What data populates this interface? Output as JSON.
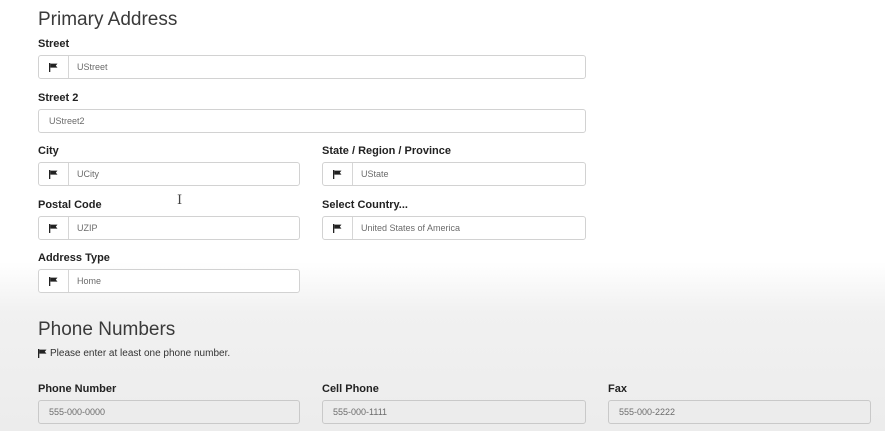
{
  "primary": {
    "title": "Primary Address",
    "street": {
      "label": "Street",
      "value": "UStreet"
    },
    "street2": {
      "label": "Street 2",
      "value": "UStreet2"
    },
    "city": {
      "label": "City",
      "value": "UCity"
    },
    "state": {
      "label": "State / Region / Province",
      "value": "UState"
    },
    "postal": {
      "label": "Postal Code",
      "value": "UZIP"
    },
    "country": {
      "label": "Select Country...",
      "value": "United States of America"
    },
    "address_type": {
      "label": "Address Type",
      "value": "Home"
    }
  },
  "phones": {
    "title": "Phone Numbers",
    "note": "Please enter at least one phone number.",
    "phone": {
      "label": "Phone Number",
      "placeholder": "555-000-0000"
    },
    "cell": {
      "label": "Cell Phone",
      "placeholder": "555-000-1111"
    },
    "fax": {
      "label": "Fax",
      "placeholder": "555-000-2222"
    }
  },
  "icons": {
    "flag": "flag-icon",
    "cursor": "text-cursor-icon"
  }
}
